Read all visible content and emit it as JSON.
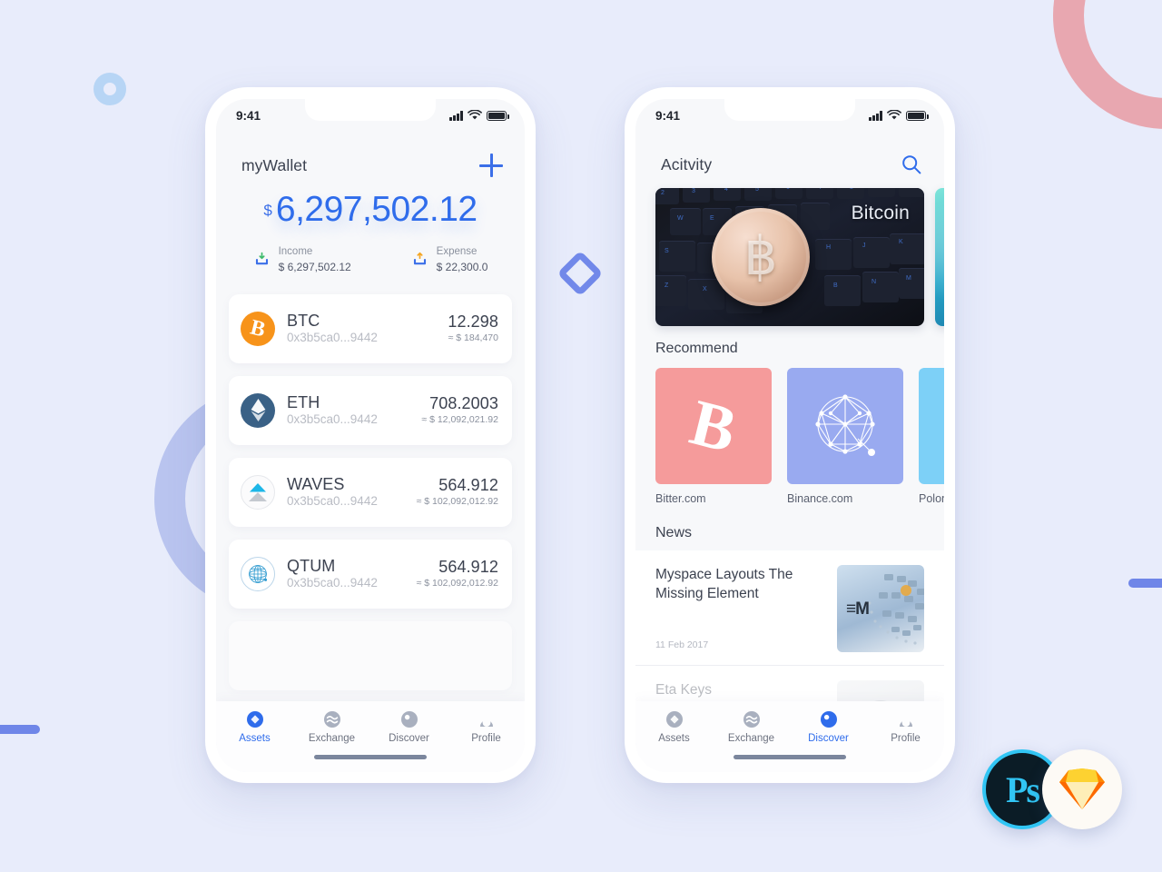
{
  "theme": {
    "background": "#e8ecfb",
    "accent": "#2f6ceb",
    "phone_body": "#ffffff",
    "screen_bg": "#f7f8fa",
    "muted_text": "#8b919e"
  },
  "decorations": [
    {
      "name": "ring-pink",
      "color": "#e8a7b0"
    },
    {
      "name": "ring-blue-small",
      "color": "#b7d5f5"
    },
    {
      "name": "ring-periwinkle",
      "color": "#b9c4ef"
    },
    {
      "name": "bar-left",
      "color": "#6f86e8"
    },
    {
      "name": "bar-right",
      "color": "#6f86e8"
    },
    {
      "name": "diamond-outline",
      "color": "#7289ea"
    }
  ],
  "badges": {
    "photoshop": {
      "label": "Ps",
      "bg": "#0b1c26",
      "ring": "#31c5f4",
      "text": "#31c5f4"
    },
    "sketch": {
      "label": "sketch-diamond",
      "bg": "#fdfaf5",
      "top": "#fdb300",
      "facet_light": "#fdd231",
      "facet_dark": "#fd6800"
    }
  },
  "wallet_phone": {
    "status_bar": {
      "time": "9:41",
      "signal": "signal-bars-icon",
      "wifi": "wifi-icon",
      "battery": "battery-full-icon"
    },
    "header": {
      "title": "myWallet",
      "add_icon": "plus-icon"
    },
    "balance": {
      "currency_symbol": "$",
      "amount": "6,297,502.12"
    },
    "summary": [
      {
        "icon": "income-tray-down-icon",
        "label": "Income",
        "value": "$ 6,297,502.12",
        "arrow_color": "#3fbb6d"
      },
      {
        "icon": "expense-tray-up-icon",
        "label": "Expense",
        "value": "$ 22,300.0",
        "arrow_color": "#f5a623"
      }
    ],
    "assets": [
      {
        "icon": "bitcoin-coin-icon",
        "symbol": "BTC",
        "address": "0x3b5ca0...9442",
        "amount": "12.298",
        "fiat": "≈ $ 184,470",
        "color": "#f7931a"
      },
      {
        "icon": "ethereum-coin-icon",
        "symbol": "ETH",
        "address": "0x3b5ca0...9442",
        "amount": "708.2003",
        "fiat": "≈ $ 12,092,021.92",
        "color": "#3a6186"
      },
      {
        "icon": "waves-coin-icon",
        "symbol": "WAVES",
        "address": "0x3b5ca0...9442",
        "amount": "564.912",
        "fiat": "≈ $ 102,092,012.92",
        "color": "#1eb7e8"
      },
      {
        "icon": "qtum-coin-icon",
        "symbol": "QTUM",
        "address": "0x3b5ca0...9442",
        "amount": "564.912",
        "fiat": "≈ $ 102,092,012.92",
        "color": "#2e9ad0"
      }
    ],
    "tabs": [
      {
        "icon": "assets-diamond-icon",
        "label": "Assets",
        "active": true
      },
      {
        "icon": "exchange-waves-icon",
        "label": "Exchange",
        "active": false
      },
      {
        "icon": "discover-compass-icon",
        "label": "Discover",
        "active": false
      },
      {
        "icon": "profile-person-icon",
        "label": "Profile",
        "active": false
      }
    ]
  },
  "activity_phone": {
    "status_bar": {
      "time": "9:41",
      "signal": "signal-bars-icon",
      "wifi": "wifi-icon",
      "battery": "battery-full-icon"
    },
    "header": {
      "title": "Acitvity",
      "search_icon": "search-icon"
    },
    "banners": [
      {
        "label": "Bitcoin",
        "art": "bitcoin-coin-on-keyboard-photo"
      },
      {
        "label": "",
        "art": "teal-abstract-photo"
      }
    ],
    "recommend": {
      "title": "Recommend",
      "items": [
        {
          "name": "Bitter.com",
          "icon": "bitcoin-b-icon",
          "bg": "#f59b9b"
        },
        {
          "name": "Binance.com",
          "icon": "binance-network-sphere-icon",
          "bg": "#99aaf0"
        },
        {
          "name": "Poloniex.com",
          "icon": "poloniex-icon",
          "bg": "#7dd0f7"
        }
      ]
    },
    "news": {
      "title": "News",
      "items": [
        {
          "title": "Myspace Layouts The Missing Element",
          "date": "11 Feb 2017",
          "thumb": "ibm-servers-photo"
        },
        {
          "title": "Eta Keys",
          "date": "",
          "thumb": "portrait-photo"
        }
      ]
    },
    "tabs": [
      {
        "icon": "assets-diamond-icon",
        "label": "Assets",
        "active": false
      },
      {
        "icon": "exchange-waves-icon",
        "label": "Exchange",
        "active": false
      },
      {
        "icon": "discover-compass-icon",
        "label": "Discover",
        "active": true
      },
      {
        "icon": "profile-person-icon",
        "label": "Profile",
        "active": false
      }
    ]
  }
}
